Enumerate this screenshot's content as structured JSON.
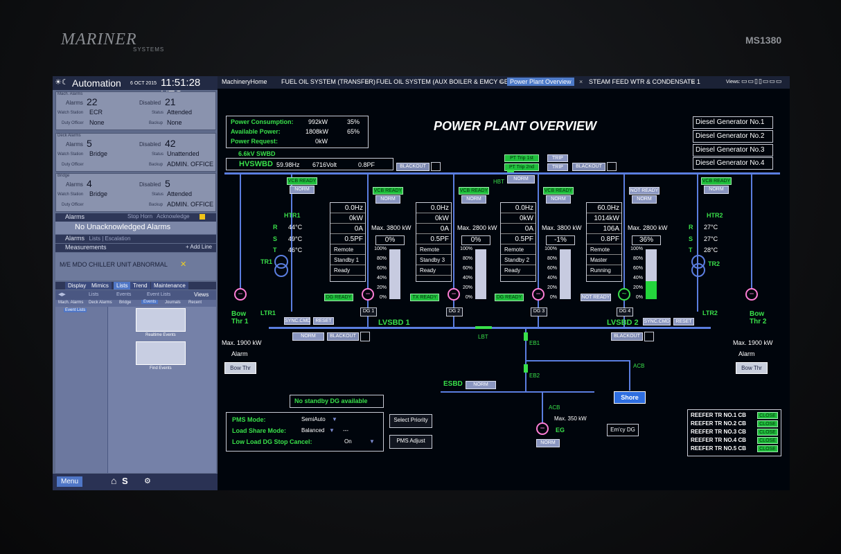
{
  "bezel": {
    "brand": "MARINER",
    "brand_sub": "SYSTEMS",
    "model": "MS1380"
  },
  "left": {
    "title": "Automation",
    "date": "6 OCT 2015",
    "time": "11:51:28 UTC",
    "mach_alarms": {
      "group": "Mach. Alarms",
      "alarms_label": "Alarms",
      "alarms": "22",
      "disabled_label": "Disabled",
      "disabled": "21",
      "watch_label": "Watch Station",
      "watch": "ECR",
      "status_label": "Status",
      "status": "Attended",
      "duty_label": "Duty Officer",
      "duty": "None",
      "backup_label": "Backup",
      "backup": "None"
    },
    "deck_alarms": {
      "group": "Deck Alarms",
      "alarms_label": "Alarms",
      "alarms": "5",
      "disabled_label": "Disabled",
      "disabled": "42",
      "watch_label": "Watch Station",
      "watch": "Bridge",
      "status_label": "Status",
      "status": "Unattended",
      "duty_label": "Duty Officer",
      "backup_label": "Backup",
      "backup": "ADMIN. OFFICE"
    },
    "bridge": {
      "group": "Bridge",
      "alarms_label": "Alarms",
      "alarms": "4",
      "disabled_label": "Disabled",
      "disabled": "5",
      "watch_label": "Watch Station",
      "watch": "Bridge",
      "status_label": "Status",
      "status": "Attended",
      "duty_label": "Duty Officer",
      "backup_label": "Backup",
      "backup": "ADMIN. OFFICE"
    },
    "alarms_bar": "Alarms",
    "stop_horn": "Stop Horn",
    "acknowledge": "Acknowledge",
    "no_unack": "No Unacknowledged Alarms",
    "alarms_bar2": "Alarms",
    "lists_escalation": "Lists | Escalation",
    "measurements": "Measurements",
    "add_line": "+ Add Line",
    "chiller_alarm": "M/E MDO CHILLER UNIT ABNORMAL",
    "tabs": [
      "Display",
      "Mimics",
      "Lists",
      "Trend",
      "Maintenance"
    ],
    "crumbs": [
      "Lists",
      "Events",
      "Event Lists"
    ],
    "views": "Views",
    "subtabs": [
      "Mach. Alarms",
      "Deck Alarms",
      "Bridge",
      "Events",
      "Journals",
      "Recent"
    ],
    "event_lists": "Event Lists",
    "realtime_events": "Realtime Events",
    "find_events": "Find Events",
    "menu": "Menu",
    "home_s": "S"
  },
  "tabs": [
    {
      "label": "MachineryHome"
    },
    {
      "label": "FUEL OIL SYSTEM (TRANSFER)"
    },
    {
      "label": "FUEL OIL SYSTEM (AUX BOILER &  EMCY  GE)"
    },
    {
      "label": "Power Plant Overview"
    },
    {
      "label": "STEAM FEED WTR & CONDENSATE 1"
    }
  ],
  "views_label": "Views:",
  "title": "POWER PLANT OVERVIEW",
  "power": {
    "consumption_label": "Power Consumption:",
    "consumption": "992kW",
    "consumption_pct": "35%",
    "available_label": "Available Power:",
    "available": "1808kW",
    "available_pct": "65%",
    "request_label": "Power Request:",
    "request": "0kW"
  },
  "swbd": {
    "label": "6.6kV SWBD",
    "name": "HVSWBD",
    "hz": "59.98Hz",
    "volt": "6716Volt",
    "pf": "0.8PF",
    "blackout": "BLACKOUT"
  },
  "pt_trip1": "PT Trip 1st",
  "pt_trip2": "PT Trip 2nd",
  "trip": "TRIP",
  "hbt": "HBT",
  "lbt": "LBT",
  "norm": "NORM",
  "blackout": "BLACKOUT",
  "dg_nav": [
    "Diesel Generator No.1",
    "Diesel Generator No.2",
    "Diesel Generator No.3",
    "Diesel Generator No.4"
  ],
  "vcb_ready": "VCB READY",
  "not_ready": "NOT READY",
  "htr1": "HTR1",
  "htr2": "HTR2",
  "tr1": "TR1",
  "tr2": "TR2",
  "ltr1": "LTR1",
  "ltr2": "LTR2",
  "rst": [
    "R",
    "S",
    "T"
  ],
  "temps1": [
    "44°C",
    "49°C",
    "46°C"
  ],
  "temps2": [
    "27°C",
    "27°C",
    "28°C"
  ],
  "gens": [
    {
      "hz": "0.0Hz",
      "kw": "0kW",
      "a": "0A",
      "pf": "0.5PF",
      "mode": "Remote",
      "role": "Standby 1",
      "state": "Ready",
      "max": "Max. 3800 kW",
      "load": "0%",
      "level": 0,
      "ready": "DG READY",
      "name": "DG 1"
    },
    {
      "hz": "0.0Hz",
      "kw": "0kW",
      "a": "0A",
      "pf": "0.5PF",
      "mode": "Remote",
      "role": "Standby 3",
      "state": "Ready",
      "max": "Max. 2800 kW",
      "load": "0%",
      "level": 0,
      "ready": "TX READY",
      "name": "DG 2"
    },
    {
      "hz": "0.0Hz",
      "kw": "0kW",
      "a": "0A",
      "pf": "0.5PF",
      "mode": "Remote",
      "role": "Standby 2",
      "state": "Ready",
      "max": "Max. 3800 kW",
      "load": "-1%",
      "level": 0,
      "ready": "DG READY",
      "name": "DG 3"
    },
    {
      "hz": "60.0Hz",
      "kw": "1014kW",
      "a": "106A",
      "pf": "0.8PF",
      "mode": "Remote",
      "role": "Master",
      "state": "Running",
      "max": "Max. 2800 kW",
      "load": "36%",
      "level": 36,
      "ready": "NOT READY",
      "name": "DG 4"
    }
  ],
  "pct_scale": [
    "100%",
    "80%",
    "60%",
    "40%",
    "20%",
    "0%"
  ],
  "bow1": {
    "name": "Bow\nThr 1",
    "max": "Max. 1900 kW",
    "alarm": "Alarm",
    "btn": "Bow Thr"
  },
  "bow2": {
    "name": "Bow\nThr 2",
    "max": "Max. 1900 kW",
    "alarm": "Alarm",
    "btn": "Bow Thr"
  },
  "lvsbd1": "LVSBD 1",
  "lvsbd2": "LVSBD 2",
  "sync_cmd": "SYNC.CMD",
  "reset": "RESET",
  "eb1": "EB1",
  "eb2": "EB2",
  "esbd": "ESBD",
  "acb": "ACB",
  "shore": "Shore",
  "eg": {
    "label": "EG",
    "max": "Max. 350 kW",
    "btn": "Em'cy DG"
  },
  "no_standby": "No standby DG available",
  "pms": {
    "mode_label": "PMS Mode:",
    "mode": "SemiAuto",
    "share_label": "Load Share Mode:",
    "share": "Balanced",
    "share_extra": "---",
    "low_label": "Low Load DG Stop Cancel:",
    "low": "On"
  },
  "select_priority": "Select Priority",
  "pms_adjust": "PMS Adjust",
  "reefer": {
    "rows": [
      "REEFER TR NO.1 CB",
      "REEFER TR NO.2 CB",
      "REEFER TR NO.3 CB",
      "REEFER TR NO.4 CB",
      "REEFER TR NO.5 CB"
    ],
    "status": "CLOSE"
  },
  "colors": {
    "green": "#39e04a",
    "bus": "#5b7ee0",
    "pink": "#ff7ed6"
  }
}
